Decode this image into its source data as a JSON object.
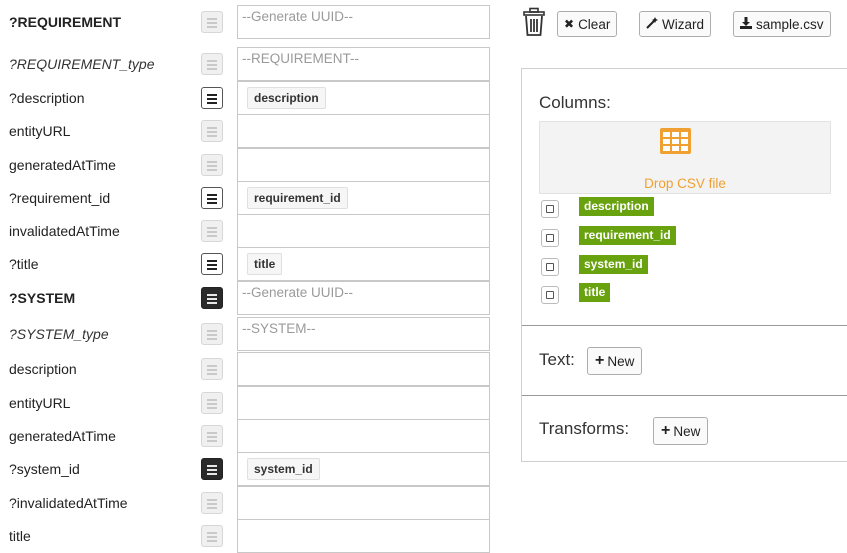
{
  "mapping_rows": [
    {
      "label": "?REQUIREMENT",
      "style": "bold",
      "toggle": "off",
      "cell_type": "placeholder",
      "cell_text": "--Generate UUID--"
    },
    {
      "label": "?REQUIREMENT_type",
      "style": "italic",
      "toggle": "off",
      "cell_type": "placeholder",
      "cell_text": "--REQUIREMENT--"
    },
    {
      "label": "?description",
      "style": "normal",
      "toggle": "on",
      "cell_type": "chip",
      "cell_text": "description"
    },
    {
      "label": "entityURL",
      "style": "normal",
      "toggle": "off",
      "cell_type": "empty",
      "cell_text": ""
    },
    {
      "label": "generatedAtTime",
      "style": "normal",
      "toggle": "off",
      "cell_type": "empty",
      "cell_text": ""
    },
    {
      "label": "?requirement_id",
      "style": "normal",
      "toggle": "on",
      "cell_type": "chip",
      "cell_text": "requirement_id"
    },
    {
      "label": "invalidatedAtTime",
      "style": "normal",
      "toggle": "off",
      "cell_type": "empty",
      "cell_text": ""
    },
    {
      "label": "?title",
      "style": "normal",
      "toggle": "on",
      "cell_type": "chip",
      "cell_text": "title"
    },
    {
      "label": "?SYSTEM",
      "style": "bold",
      "toggle": "dark",
      "cell_type": "placeholder",
      "cell_text": "--Generate UUID--"
    },
    {
      "label": "?SYSTEM_type",
      "style": "italic",
      "toggle": "off",
      "cell_type": "placeholder",
      "cell_text": "--SYSTEM--"
    },
    {
      "label": "description",
      "style": "normal",
      "toggle": "off",
      "cell_type": "empty",
      "cell_text": ""
    },
    {
      "label": "entityURL",
      "style": "normal",
      "toggle": "off",
      "cell_type": "empty",
      "cell_text": ""
    },
    {
      "label": "generatedAtTime",
      "style": "normal",
      "toggle": "off",
      "cell_type": "empty",
      "cell_text": ""
    },
    {
      "label": "?system_id",
      "style": "normal",
      "toggle": "dark",
      "cell_type": "chip",
      "cell_text": "system_id"
    },
    {
      "label": "?invalidatedAtTime",
      "style": "normal",
      "toggle": "off",
      "cell_type": "empty",
      "cell_text": ""
    },
    {
      "label": "title",
      "style": "normal",
      "toggle": "off",
      "cell_type": "empty",
      "cell_text": ""
    }
  ],
  "toolbar": {
    "trash_icon": "trash-icon",
    "clear_label": "Clear",
    "wizard_label": "Wizard",
    "sample_label": "sample.csv"
  },
  "panel": {
    "columns_title": "Columns:",
    "drop_label": "Drop CSV file",
    "columns": [
      "description",
      "requirement_id",
      "system_id",
      "title"
    ],
    "text_title": "Text:",
    "transforms_title": "Transforms:",
    "new_label": "New"
  },
  "colors": {
    "column_tag": "#69a20f",
    "drop_accent": "#f0a030"
  }
}
